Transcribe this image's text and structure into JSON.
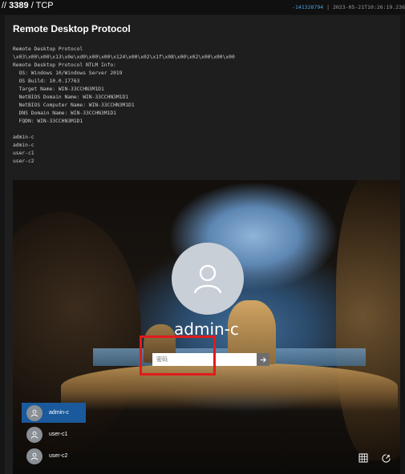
{
  "header": {
    "port": "3389",
    "protocol": "TCP",
    "hash": "-141328794",
    "separator": "|",
    "timestamp": "2023-05-21T10:26:19.236"
  },
  "card": {
    "title": "Remote Desktop Protocol",
    "banner": "Remote Desktop Protocol\n\\x03\\x00\\x00\\x13\\x0e\\xd0\\x00\\x00\\x124\\x00\\x02\\x1f\\x08\\x00\\x02\\x00\\x00\\x00\nRemote Desktop Protocol NTLM Info:\n  OS: Windows 10/Windows Server 2019\n  OS Build: 10.0.17763\n  Target Name: WIN-33CCHN3M1D1\n  NetBIOS Domain Name: WIN-33CCHN3M1D1\n  NetBIOS Computer Name: WIN-33CCHN3M1D1\n  DNS Domain Name: WIN-33CCHN3M1D1\n  FQDN: WIN-33CCHN3M1D1\n\nadmin-c\nadmin-c\nuser-c1\nuser-c2"
  },
  "login": {
    "username": "admin-c",
    "password_placeholder": "密码",
    "users": [
      {
        "label": "admin-c",
        "active": true
      },
      {
        "label": "user-c1",
        "active": false
      },
      {
        "label": "user-c2",
        "active": false
      }
    ]
  },
  "icons": {
    "avatar": "user-icon",
    "submit": "arrow-right-icon",
    "accessibility": "ease-of-access-icon",
    "power": "power-icon",
    "network": "network-icon"
  },
  "colors": {
    "accent": "#1a5a9c",
    "highlight": "#e01b1b",
    "hash": "#4aa3df"
  }
}
